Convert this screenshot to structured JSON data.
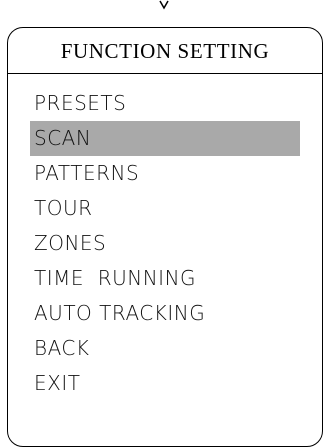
{
  "menu": {
    "title": "FUNCTION SETTING",
    "selected_index": 1,
    "items": [
      {
        "label": "PRESETS"
      },
      {
        "label": "SCAN"
      },
      {
        "label": "PATTERNS"
      },
      {
        "label": "TOUR"
      },
      {
        "label": "ZONES"
      },
      {
        "label": "TIME  RUNNING"
      },
      {
        "label": "AUTO TRACKING"
      },
      {
        "label": "BACK"
      },
      {
        "label": "EXIT"
      }
    ]
  },
  "colors": {
    "border": "#000000",
    "highlight": "#a9a9a9",
    "text": "#111111",
    "background": "#ffffff"
  }
}
